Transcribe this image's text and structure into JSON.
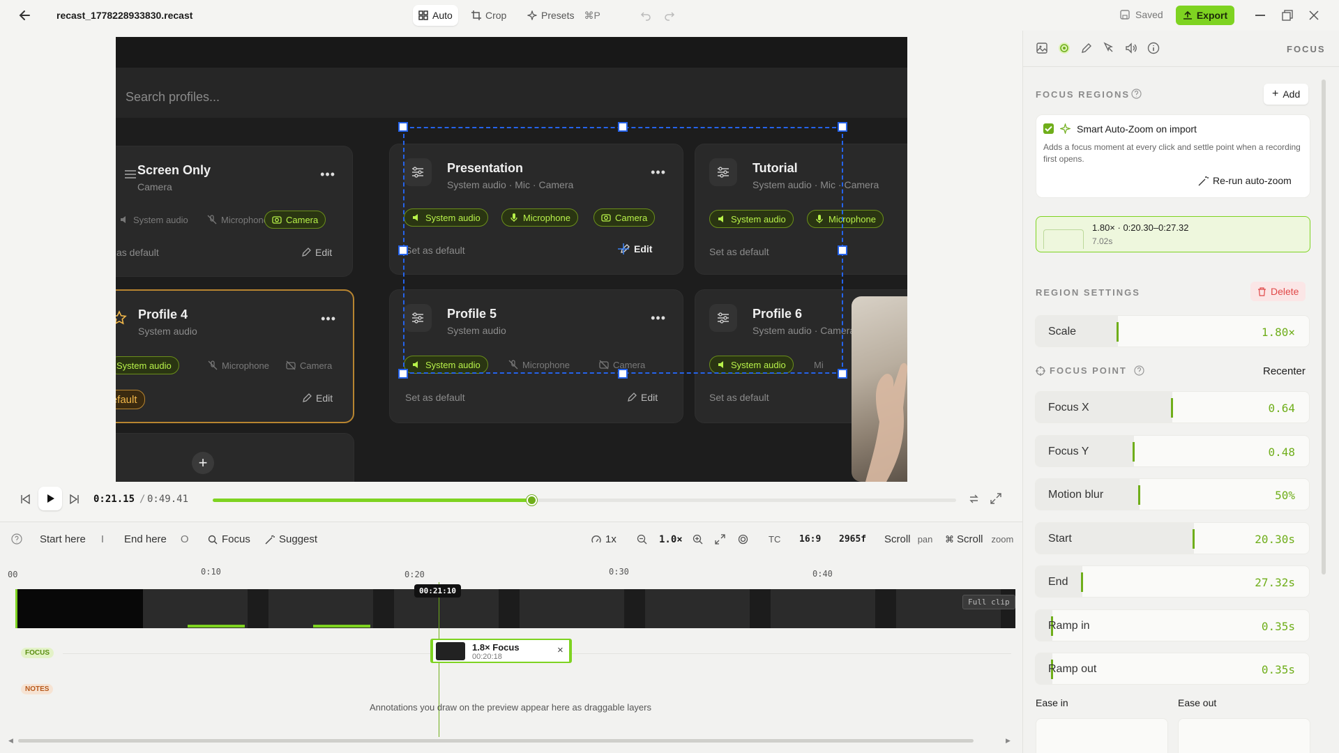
{
  "topbar": {
    "filename": "recast_1778228933830.recast",
    "auto_label": "Auto",
    "crop_label": "Crop",
    "presets_label": "Presets",
    "presets_shortcut": "⌘P",
    "saved_label": "Saved",
    "export_label": "Export"
  },
  "preview": {
    "search_placeholder": "Search profiles...",
    "cards": [
      {
        "name": "Screen Only",
        "sub": "Camera",
        "chips": [
          "System audio",
          "Microphone",
          "Camera"
        ],
        "foot": "as default",
        "edit": "Edit"
      },
      {
        "name": "Presentation",
        "sub": "System audio · Mic · Camera",
        "chips": [
          "System audio",
          "Microphone",
          "Camera"
        ],
        "foot": "Set as default",
        "edit": "Edit"
      },
      {
        "name": "Tutorial",
        "sub": "System audio · Mic · Camera",
        "chips": [
          "System audio",
          "Microphone"
        ],
        "foot": "Set as default"
      },
      {
        "name": "Profile 4",
        "sub": "System audio",
        "chips": [
          "System audio",
          "Microphone",
          "Camera"
        ],
        "badge": "Default",
        "edit": "Edit"
      },
      {
        "name": "Profile 5",
        "sub": "System audio",
        "chips": [
          "System audio",
          "Microphone",
          "Camera"
        ],
        "foot": "Set as default",
        "edit": "Edit"
      },
      {
        "name": "Profile 6",
        "sub": "System audio · Camera",
        "chips": [
          "System audio",
          "Mi"
        ],
        "foot": "Set as default"
      }
    ],
    "add_symbol": "+"
  },
  "playback": {
    "current": "0:21.15",
    "separator": "/",
    "total": "0:49.41",
    "progress": 0.43
  },
  "timeline": {
    "start_here": "Start here",
    "start_key": "I",
    "end_here": "End here",
    "end_key": "O",
    "focus": "Focus",
    "suggest": "Suggest",
    "speed": "1x",
    "zoom": "1.0×",
    "tc": "TC",
    "aspect": "16:9",
    "frames": "2965f",
    "scroll": "Scroll",
    "pan": "pan",
    "scroll2": "Scroll",
    "zoom_label": "zoom",
    "ruler": [
      "00",
      "0:10",
      "0:20",
      "0:30",
      "0:40"
    ],
    "playhead_time": "00:21:10",
    "full_clip": "Full clip",
    "focus_tag": "FOCUS",
    "notes_tag": "NOTES",
    "clip_title": "1.8× Focus",
    "clip_time": "00:20:18",
    "clip_close": "×",
    "notes_hint": "Annotations you draw on the preview appear here as draggable layers"
  },
  "panel": {
    "header": "FOCUS",
    "focus_regions": "FOCUS REGIONS",
    "add": "Add",
    "smart_title": "Smart Auto-Zoom on import",
    "smart_desc": "Adds a focus moment at every click and settle point when a recording first opens.",
    "rerun": "Re-run auto-zoom",
    "region_title": "1.80× · 0:20.30–0:27.32",
    "region_dur": "7.02s",
    "region_settings": "REGION SETTINGS",
    "delete": "Delete",
    "focus_point": "FOCUS POINT",
    "recenter": "Recenter",
    "ease_in": "Ease in",
    "ease_out": "Ease out",
    "sliders": [
      {
        "label": "Scale",
        "value": "1.80×",
        "level": 0.3
      },
      {
        "label": "Focus X",
        "value": "0.64",
        "level": 0.5
      },
      {
        "label": "Focus Y",
        "value": "0.48",
        "level": 0.36
      },
      {
        "label": "Motion blur",
        "value": "50%",
        "level": 0.38
      },
      {
        "label": "Start",
        "value": "20.30s",
        "level": 0.58
      },
      {
        "label": "End",
        "value": "27.32s",
        "level": 0.17
      },
      {
        "label": "Ramp in",
        "value": "0.35s",
        "level": 0.06
      },
      {
        "label": "Ramp out",
        "value": "0.35s",
        "level": 0.06
      }
    ]
  },
  "colors": {
    "accent": "#7ed321",
    "accent_dark": "#6fae1a",
    "selection": "#2563eb",
    "highlight": "#b88530"
  }
}
